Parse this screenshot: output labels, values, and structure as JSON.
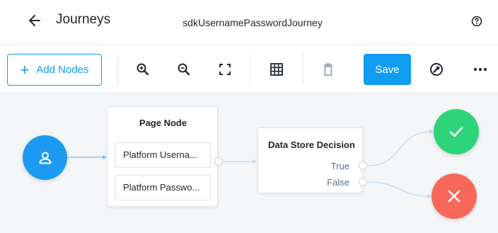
{
  "header": {
    "back_icon": "arrow-left-icon",
    "title": "Journeys",
    "journey_name": "sdkUsernamePasswordJourney",
    "help_icon": "help-circle-icon"
  },
  "toolbar": {
    "add_nodes_label": "Add Nodes",
    "save_label": "Save",
    "tools": [
      "zoom-in-icon",
      "zoom-out-icon",
      "fit-screen-icon",
      "grid-icon",
      "trash-icon",
      "wrench-icon",
      "more-icon"
    ]
  },
  "canvas": {
    "start_node_icon": "user-icon",
    "page_node": {
      "title": "Page Node",
      "items": [
        "Platform Userna...",
        "Platform Passwo..."
      ]
    },
    "decision_node": {
      "title": "Data Store Decision",
      "outcomes": [
        "True",
        "False"
      ]
    },
    "success_icon": "check-icon",
    "failure_icon": "x-icon"
  },
  "colors": {
    "accent": "#109cf1",
    "success": "#2ed47a",
    "failure": "#f7685b",
    "start": "#1c9af1"
  }
}
